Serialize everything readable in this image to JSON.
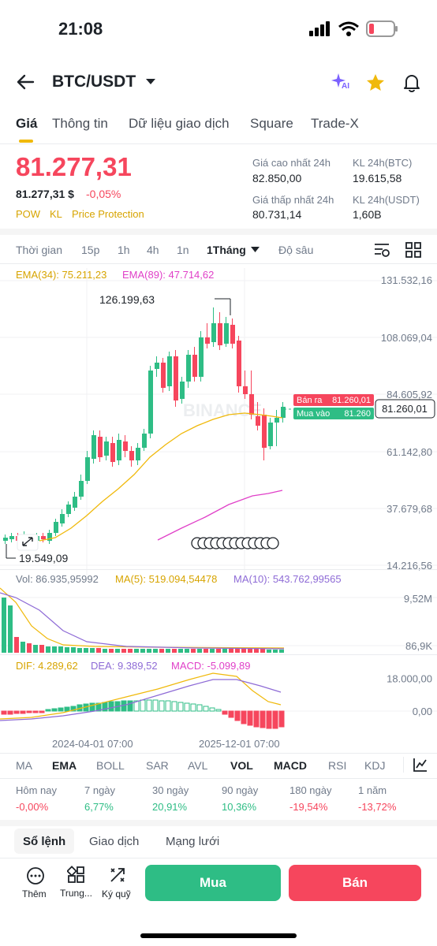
{
  "status": {
    "time": "21:08"
  },
  "header": {
    "pair": "BTC/USDT",
    "ai_label": "AI"
  },
  "tabs": [
    "Giá",
    "Thông tin",
    "Dữ liệu giao dịch",
    "Square",
    "Trade-X"
  ],
  "price": {
    "last": "81.277,31",
    "usd": "81.277,31 $",
    "change": "-0,05%",
    "tags": [
      "POW",
      "KL",
      "Price Protection"
    ]
  },
  "stats": {
    "high_label": "Giá cao nhất 24h",
    "high_value": "82.850,00",
    "low_label": "Giá thấp nhất 24h",
    "low_value": "80.731,14",
    "vol_btc_label": "KL 24h(BTC)",
    "vol_btc_value": "19.615,58",
    "vol_usdt_label": "KL 24h(USDT)",
    "vol_usdt_value": "1,60B"
  },
  "timeframes": {
    "time_label": "Thời gian",
    "items": [
      "15p",
      "1h",
      "4h",
      "1n"
    ],
    "active": "1Tháng",
    "depth": "Độ sâu"
  },
  "chart": {
    "ema34": "EMA(34): 75.211,23",
    "ema89": "EMA(89): 47.714,62",
    "y_ticks": [
      "131.532,16",
      "108.069,04",
      "84.605,92",
      "61.142,80",
      "37.679,68",
      "14.216,56"
    ],
    "high_label": "126.199,63",
    "low_label": "19.549,09",
    "current_price": "81.260,01",
    "ask_label": "Bán ra",
    "ask_value": "81.260,01",
    "bid_label": "Mua vào",
    "bid_value": "81.260",
    "watermark": "BINANCE",
    "colors": {
      "up": "#2ebd85",
      "down": "#f6465d",
      "ema34": "#f0b90b",
      "ema89": "#e040c8",
      "ma10": "#8e6bd6"
    }
  },
  "volume": {
    "vol": "Vol: 86.935,95992",
    "ma5": "MA(5): 519.094,54478",
    "ma10": "MA(10): 543.762,99565",
    "y_top": "9,52M",
    "y_bottom": "86,9K"
  },
  "macd": {
    "dif": "DIF: 4.289,62",
    "dea": "DEA: 9.389,52",
    "macd": "MACD: -5.099,89",
    "y_top": "18.000,00",
    "y_zero": "0,00"
  },
  "dates": [
    "2024-04-01 07:00",
    "2025-12-01 07:00"
  ],
  "indicators": [
    "MA",
    "EMA",
    "BOLL",
    "SAR",
    "AVL",
    "VOL",
    "MACD",
    "RSI",
    "KDJ"
  ],
  "performance": [
    {
      "label": "Hôm nay",
      "value": "-0,00%",
      "dir": "down"
    },
    {
      "label": "7 ngày",
      "value": "6,77%",
      "dir": "up"
    },
    {
      "label": "30 ngày",
      "value": "20,91%",
      "dir": "up"
    },
    {
      "label": "90 ngày",
      "value": "10,36%",
      "dir": "up"
    },
    {
      "label": "180 ngày",
      "value": "-19,54%",
      "dir": "down"
    },
    {
      "label": "1 năm",
      "value": "-13,72%",
      "dir": "down"
    }
  ],
  "bottom_tabs": [
    "Sổ lệnh",
    "Giao dịch",
    "Mạng lưới"
  ],
  "actions": {
    "more": "Thêm",
    "center": "Trung...",
    "margin": "Ký quỹ",
    "buy": "Mua",
    "sell": "Bán"
  }
}
